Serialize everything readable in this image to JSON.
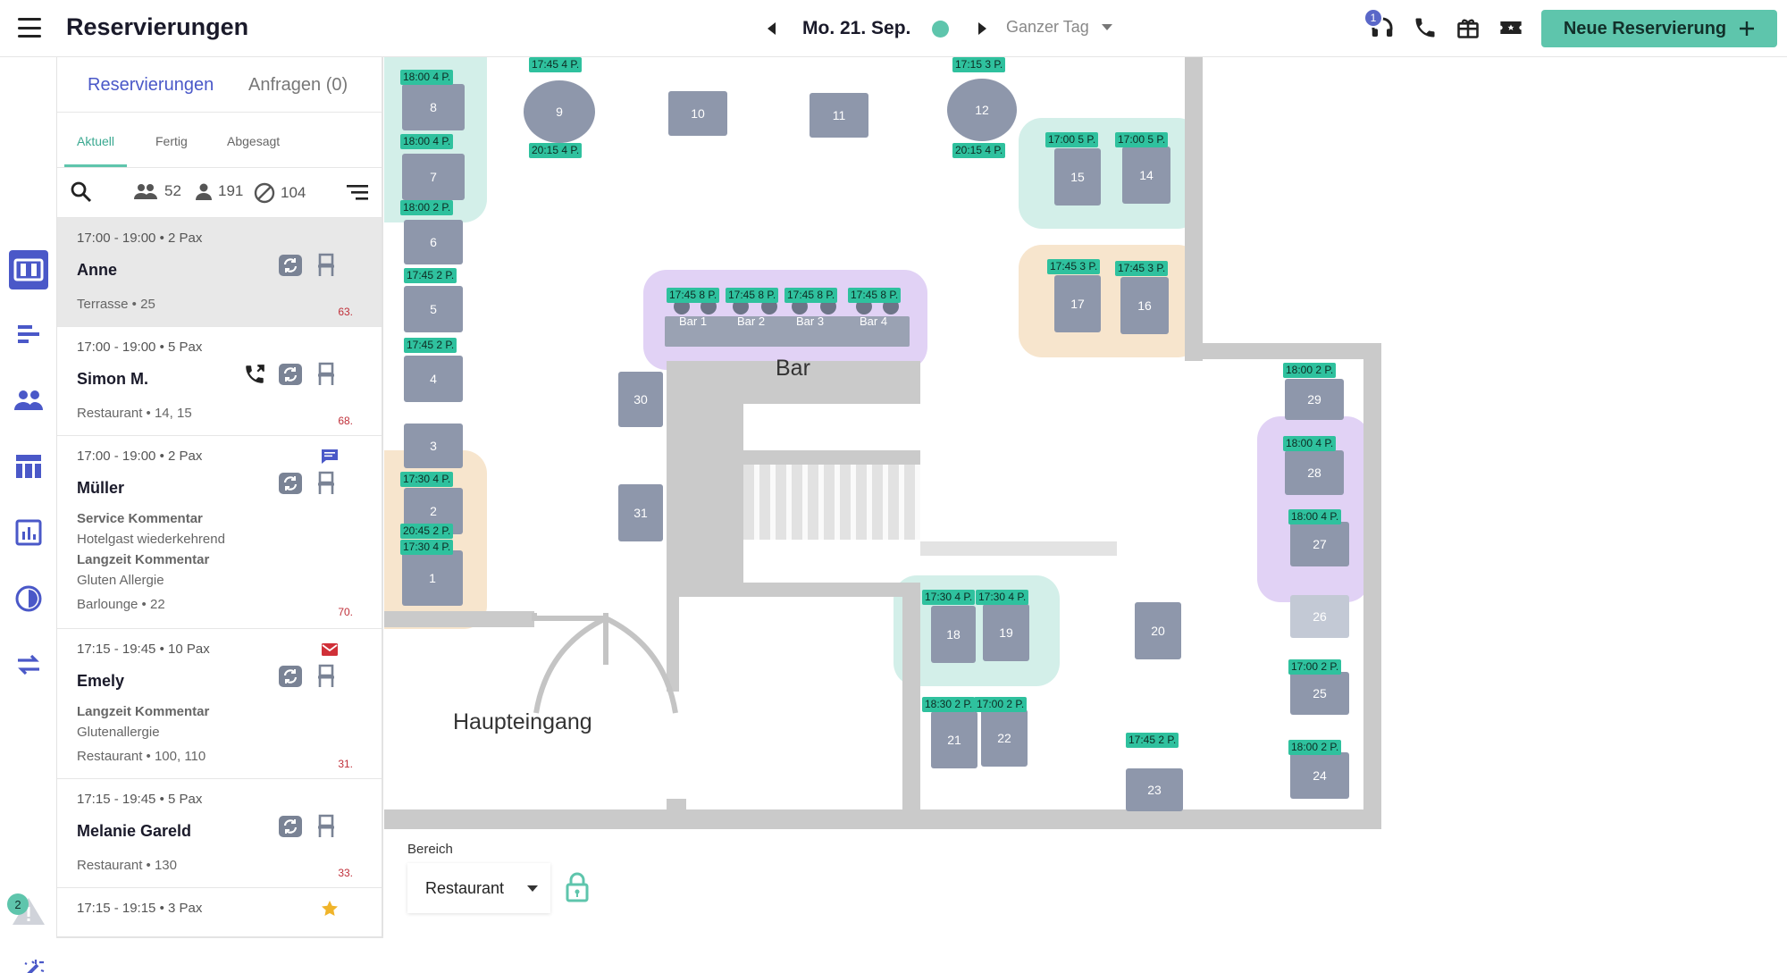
{
  "header": {
    "title": "Reservierungen",
    "date": "Mo. 21. Sep.",
    "range": "Ganzer Tag",
    "notification_count": "1",
    "new_button": "Neue Reservierung"
  },
  "nav": {
    "alert_count": "2"
  },
  "panel": {
    "tabs": [
      "Reservierungen",
      "Anfragen (0)"
    ],
    "subtabs": [
      "Aktuell",
      "Fertig",
      "Abgesagt"
    ],
    "stats": {
      "groups": "52",
      "persons": "191",
      "cancelled": "104"
    }
  },
  "reservations": [
    {
      "time": "17:00 - 19:00 • 2 Pax",
      "name": "Anne",
      "location": "Terrasse • 25",
      "number": "63."
    },
    {
      "time": "17:00 - 19:00 • 5 Pax",
      "name": "Simon M.",
      "location": "Restaurant • 14, 15",
      "number": "68."
    },
    {
      "time": "17:00 - 19:00 • 2 Pax",
      "name": "Müller",
      "comment1_title": "Service Kommentar",
      "comment1_text": "Hotelgast wiederkehrend",
      "comment2_title": "Langzeit Kommentar",
      "comment2_text": "Gluten Allergie",
      "location": "Barlounge • 22",
      "number": "70."
    },
    {
      "time": "17:15 - 19:45 • 10 Pax",
      "name": "Emely",
      "comment1_title": "Langzeit Kommentar",
      "comment1_text": "Glutenallergie",
      "location": "Restaurant • 100, 110",
      "number": "31."
    },
    {
      "time": "17:15 - 19:45 • 5 Pax",
      "name": "Melanie Gareld",
      "location": "Restaurant • 130",
      "number": "33."
    },
    {
      "time": "17:15 - 19:15 • 3 Pax"
    }
  ],
  "floor": {
    "tables": {
      "t1": "1",
      "t2": "2",
      "t3": "3",
      "t4": "4",
      "t5": "5",
      "t6": "6",
      "t7": "7",
      "t8": "8",
      "t9": "9",
      "t10": "10",
      "t11": "11",
      "t12": "12",
      "t14": "14",
      "t15": "15",
      "t16": "16",
      "t17": "17",
      "t18": "18",
      "t19": "19",
      "t20": "20",
      "t21": "21",
      "t22": "22",
      "t23": "23",
      "t24": "24",
      "t25": "25",
      "t26": "26",
      "t27": "27",
      "t28": "28",
      "t29": "29",
      "t30": "30",
      "t31": "31"
    },
    "bar_seats": [
      "Bar 1",
      "Bar 2",
      "Bar 3",
      "Bar 4"
    ],
    "labels": {
      "l8": "18:00 4 P.",
      "l7": "18:00 4 P.",
      "l6": "18:00 2 P.",
      "l5": "17:45 2 P.",
      "l4": "17:45 2 P.",
      "l2": "17:30 4 P.",
      "l1a": "20:45 2 P.",
      "l1b": "17:30 4 P.",
      "l9a": "17:45 4 P.",
      "l9b": "20:15 4 P.",
      "l12a": "17:15 3 P.",
      "l12b": "20:15 4 P.",
      "l15": "17:00 5 P.",
      "l14": "17:00 5 P.",
      "l17": "17:45 3 P.",
      "l16": "17:45 3 P.",
      "lb1": "17:45 8 P.",
      "lb2": "17:45 8 P.",
      "lb3": "17:45 8 P.",
      "lb4": "17:45 8 P.",
      "l18": "17:30 4 P.",
      "l19": "17:30 4 P.",
      "l21": "18:30 2 P.",
      "l22": "17:00 2 P.",
      "l23": "17:45 2 P.",
      "l29": "18:00 2 P.",
      "l28": "18:00 4 P.",
      "l27": "18:00 4 P.",
      "l25": "17:00 2 P.",
      "l24": "18:00 2 P."
    },
    "bar_label": "Bar",
    "entrance_label": "Haupteingang",
    "bereich_label": "Bereich",
    "area_value": "Restaurant"
  },
  "colors": {
    "accent": "#5ec5ac",
    "primary": "#4a58c8",
    "table": "#8e97ab",
    "label": "#2fc19e"
  }
}
